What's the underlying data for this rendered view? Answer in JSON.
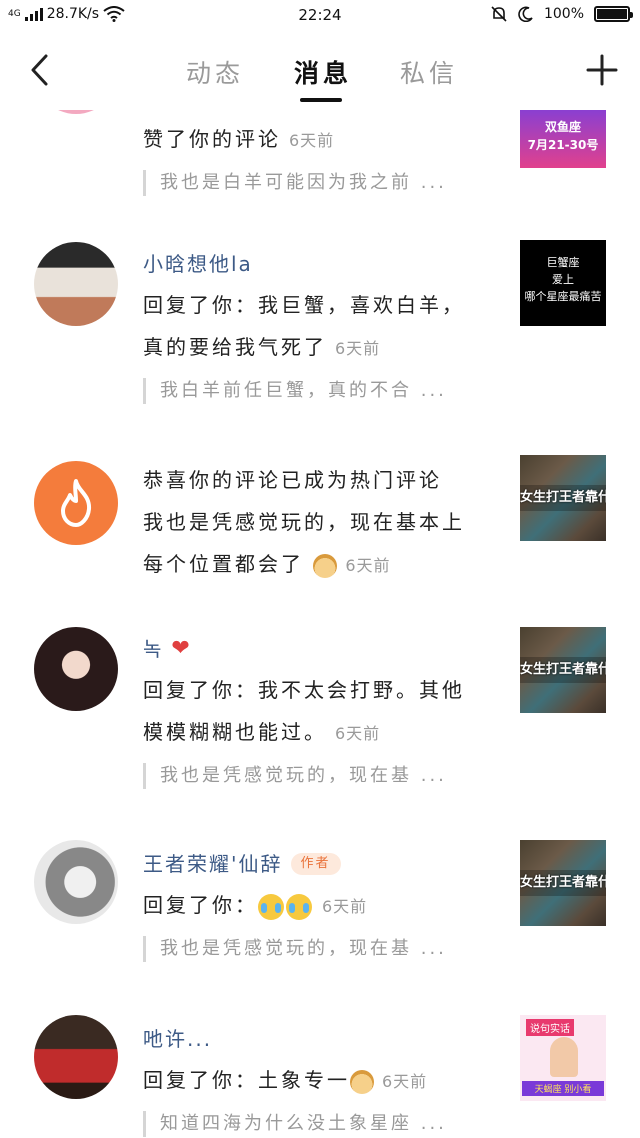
{
  "status_bar": {
    "network": "4G",
    "speed": "28.7K/s",
    "time": "22:24",
    "battery": "100%",
    "battery_level": 1.0
  },
  "header": {
    "tabs": [
      {
        "label": "动态",
        "active": false
      },
      {
        "label": "消息",
        "active": true
      },
      {
        "label": "私信",
        "active": false
      }
    ]
  },
  "messages": [
    {
      "name": "",
      "text": "赞了你的评论",
      "time": "6天前",
      "quote": "我也是白羊可能因为我之前 ...",
      "thumb_text_1": "双鱼座",
      "thumb_text_2": "7月21-30号"
    },
    {
      "name": "小晗想他la",
      "text_line1": "回复了你：我巨蟹，喜欢白羊，",
      "text_line2": "真的要给我气死了",
      "time": "6天前",
      "quote": "我白羊前任巨蟹，真的不合 ...",
      "thumb_line1": "巨蟹座",
      "thumb_line2": "爱上",
      "thumb_line3": "哪个星座最痛苦"
    },
    {
      "text_line1": "恭喜你的评论已成为热门评论",
      "text_line2": "我也是凭感觉玩的，现在基本上",
      "text_line3": "每个位置都会了",
      "time": "6天前",
      "thumb_caption": "女生打王者靠什么"
    },
    {
      "name": "녹",
      "text_line1": "回复了你：我不太会打野。其他",
      "text_line2": "模模糊糊也能过。",
      "time": "6天前",
      "quote": "我也是凭感觉玩的，现在基 ...",
      "thumb_caption": "女生打王者靠什么"
    },
    {
      "name": "王者荣耀'仙辞",
      "badge": "作者",
      "text": "回复了你：",
      "time": "6天前",
      "quote": "我也是凭感觉玩的，现在基 ...",
      "thumb_caption": "女生打王者靠什么"
    },
    {
      "name": "吔许...",
      "text": "回复了你：土象专一",
      "time": "6天前",
      "quote": "知道四海为什么没土象星座 ...",
      "thumb_top": "说句实话",
      "thumb_bottom": "天蝎座 别小看"
    }
  ],
  "colors": {
    "accent_orange": "#f47c3c",
    "name_blue": "#3d5a86",
    "muted_gray": "#9a9a9a"
  }
}
